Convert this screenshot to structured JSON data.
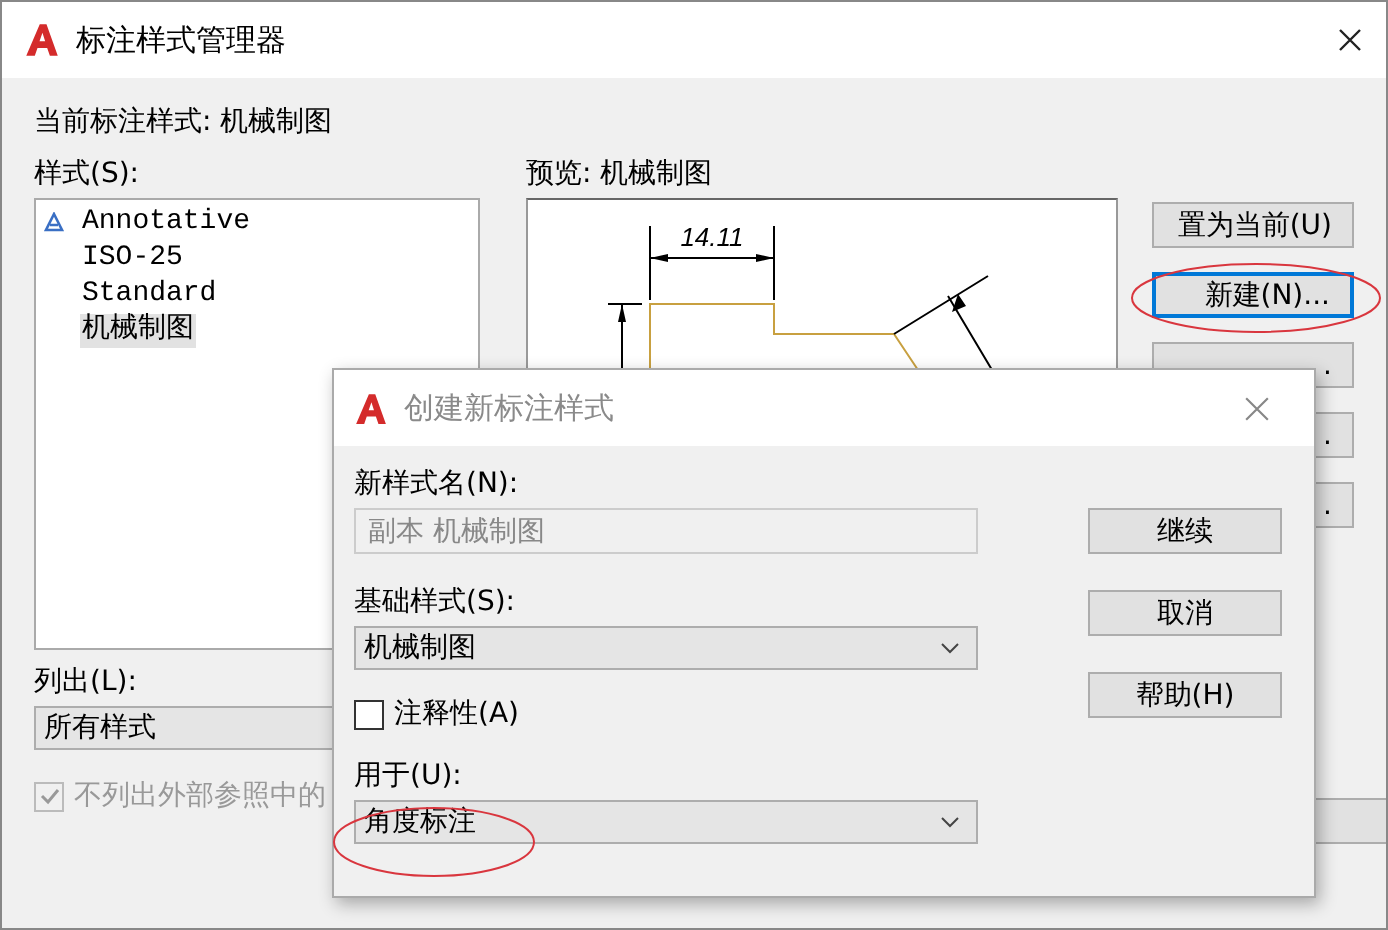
{
  "window": {
    "title": "标注样式管理器"
  },
  "current_style": "当前标注样式: 机械制图",
  "styles": {
    "label": "样式(S):",
    "items": [
      {
        "name": "Annotative",
        "annotative": true,
        "selected": false
      },
      {
        "name": "ISO-25",
        "annotative": false,
        "selected": false
      },
      {
        "name": "Standard",
        "annotative": false,
        "selected": false
      },
      {
        "name": "机械制图",
        "annotative": false,
        "selected": true
      }
    ]
  },
  "preview": {
    "label": "预览: 机械制图",
    "dimension": "14.11"
  },
  "buttons": [
    {
      "label": "置为当前(U)",
      "focused": false,
      "circled": false
    },
    {
      "label": "新建(N)...",
      "focused": true,
      "circled": true
    },
    {
      "label": ".",
      "focused": false,
      "circled": false
    },
    {
      "label": ".",
      "focused": false,
      "circled": false
    },
    {
      "label": ".",
      "focused": false,
      "circled": false
    }
  ],
  "list": {
    "label": "列出(L):",
    "value": "所有样式"
  },
  "exclude_xref": {
    "label": "不列出外部参照中的",
    "checked": true,
    "disabled": true
  },
  "dialog": {
    "title": "创建新标注样式",
    "new_name": {
      "label": "新样式名(N):",
      "value": "副本 机械制图",
      "disabled": true
    },
    "base_style": {
      "label": "基础样式(S):",
      "value": "机械制图"
    },
    "annotative": {
      "label": "注释性(A)",
      "checked": false
    },
    "use_for": {
      "label": "用于(U):",
      "value": "角度标注",
      "circled": true
    },
    "buttons": [
      {
        "label": "继续"
      },
      {
        "label": "取消"
      },
      {
        "label": "帮助(H)"
      }
    ]
  }
}
